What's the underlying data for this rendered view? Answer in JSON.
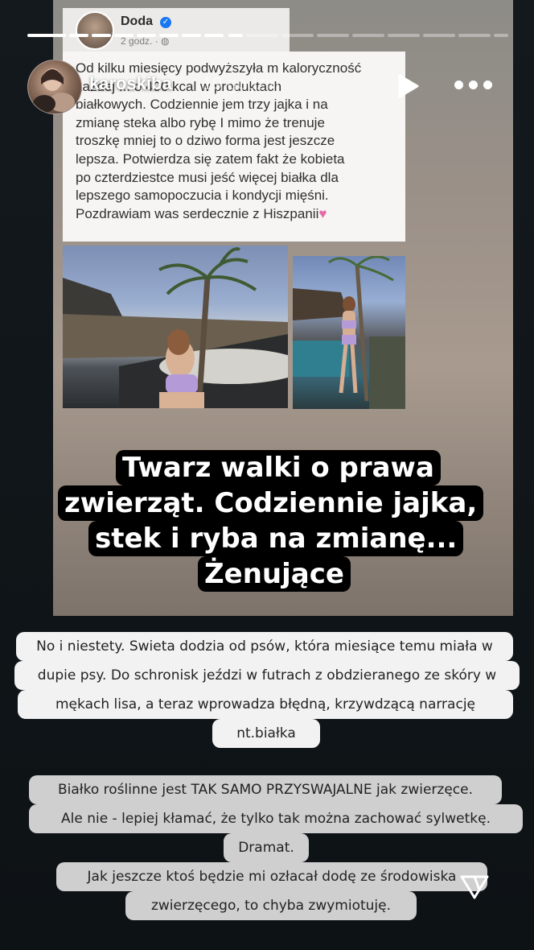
{
  "story": {
    "username": "karoskiba",
    "time": "19 godzin"
  },
  "post": {
    "author": "Doda",
    "time": "2 godz. · ",
    "text_lines": [
      "Od kilku miesięcy podwyższyła m kaloryczność",
      "każdej ... o 400 kcal w produktach",
      "białkowych. Codziennie jem trzy jajka i na",
      "zmianę steka albo rybę I mimo że trenuje",
      "troszkę mniej to o dziwo forma jest jeszcze",
      "lepsza. Potwierdza się zatem fakt że kobieta",
      "po czterdziestce musi jeść więcej białka dla",
      "lepszego samopoczucia i kondycji mięśni.",
      "Pozdrawiam was serdecznie z Hiszpanii"
    ]
  },
  "caption_lines": [
    "Twarz walki o prawa",
    "zwierząt. Codziennie jajka,",
    "stek i ryba na zmianę...",
    "Żenujące"
  ],
  "note1_lines": [
    "No i niestety. Swieta dodzia od psów, która miesiące temu miała w",
    "dupie psy. Do schronisk jeździ w futrach z obdzieranego ze skóry w",
    "mękach lisa, a teraz wprowadza błędną, krzywdzącą narrację",
    "nt.białka"
  ],
  "note2_lines": [
    "Białko roślinne jest TAK SAMO PRZYSWAJALNE jak zwierzęce.",
    "Ale nie - lepiej kłamać, że tylko tak można zachować sylwetkę.",
    "Dramat."
  ],
  "note3_lines": [
    "Jak jeszcze ktoś będzie mi ozłacał dodę ze środowiska",
    "zwierzęcego, to chyba zwymiotuję."
  ],
  "icons": {
    "play": "play-icon",
    "more": "more-icon",
    "verified": "verified-icon",
    "public": "globe-icon",
    "heart": "heart-emoji",
    "cut": "cut-icon"
  },
  "colors": {
    "heart": "#e56aa8",
    "verified": "#1877f2"
  }
}
